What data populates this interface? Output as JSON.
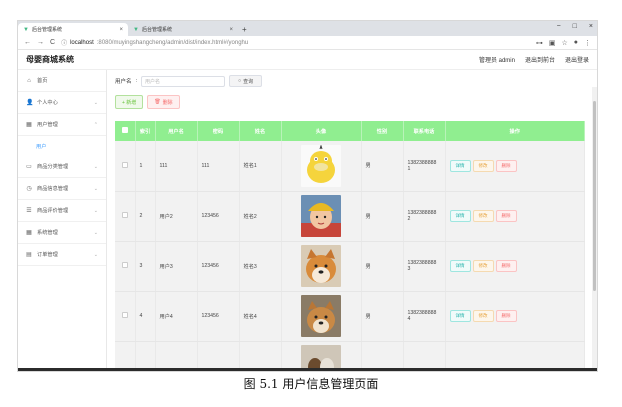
{
  "browser": {
    "tabs": [
      {
        "title": "后台管理系统",
        "close": "×"
      },
      {
        "title": "后台管理系统",
        "close": "×"
      }
    ],
    "newtab": "+",
    "window_controls": [
      "−",
      "□",
      "×"
    ],
    "url_prefix": "localhost",
    "url_rest": ":8080/muyingshangcheng/admin/dist/index.html#/yonghu"
  },
  "header": {
    "brand": "母婴商城系统",
    "admin": "管理员 admin",
    "front": "退出到前台",
    "logout": "退出登录"
  },
  "sidebar": {
    "items": [
      {
        "label": "首页",
        "icon": "⌂",
        "arrow": ""
      },
      {
        "label": "个人中心",
        "icon": "👤",
        "arrow": "⌄"
      },
      {
        "label": "用户管理",
        "icon": "▦",
        "arrow": "⌃"
      },
      {
        "label": "用户",
        "icon": "",
        "arrow": ""
      },
      {
        "label": "商品分类管理",
        "icon": "▭",
        "arrow": "⌄"
      },
      {
        "label": "商品信息管理",
        "icon": "◷",
        "arrow": "⌄"
      },
      {
        "label": "商品评价管理",
        "icon": "☰",
        "arrow": "⌄"
      },
      {
        "label": "系统管理",
        "icon": "▦",
        "arrow": "⌄"
      },
      {
        "label": "订单管理",
        "icon": "▤",
        "arrow": "⌄"
      }
    ]
  },
  "search": {
    "label": "用户名",
    "placeholder": "用户名",
    "button": "查询"
  },
  "ops": {
    "add": "+ 新增",
    "delete": "删除"
  },
  "table": {
    "headers": [
      "",
      "索引",
      "用户名",
      "密码",
      "姓名",
      "头像",
      "性别",
      "联系电话",
      "操作"
    ],
    "rows": [
      {
        "idx": "1",
        "username": "111",
        "password": "111",
        "name": "姓名1",
        "gender": "男",
        "phone": "1382388888\n1"
      },
      {
        "idx": "2",
        "username": "用户2",
        "password": "123456",
        "name": "姓名2",
        "gender": "男",
        "phone": "1382388888\n2"
      },
      {
        "idx": "3",
        "username": "用户3",
        "password": "123456",
        "name": "姓名3",
        "gender": "男",
        "phone": "1382388888\n3"
      },
      {
        "idx": "4",
        "username": "用户4",
        "password": "123456",
        "name": "姓名4",
        "gender": "男",
        "phone": "1382388888\n4"
      }
    ],
    "actions": {
      "detail": "详情",
      "edit": "修改",
      "del": "删除"
    }
  },
  "caption": "图 5.1  用户信息管理页面"
}
